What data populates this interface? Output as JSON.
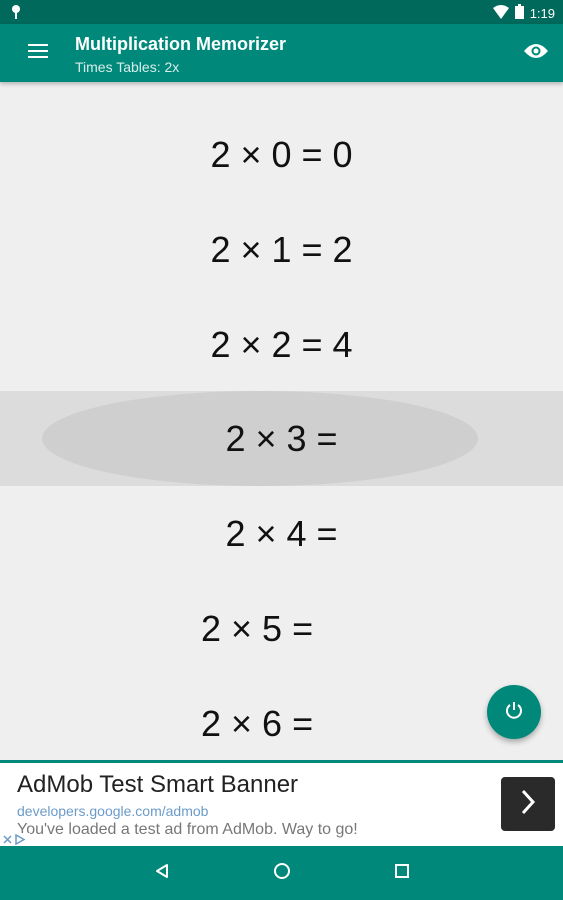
{
  "status_bar": {
    "time": "1:19",
    "icons": [
      "pin-icon",
      "wifi-icon",
      "battery-icon"
    ]
  },
  "app_bar": {
    "title": "Multiplication Memorizer",
    "subtitle": "Times Tables: 2x",
    "icons": [
      "menu-icon",
      "eye-icon"
    ]
  },
  "equations": [
    "2 × 0 = 0",
    "2 × 1 = 2",
    "2 × 2 = 4",
    "2 × 3 =",
    "2 × 4 =",
    "2 × 5 =",
    "2 × 6 ="
  ],
  "fab": {
    "icon": "power-icon"
  },
  "ad": {
    "title": "AdMob Test Smart Banner",
    "url": "developers.google.com/admob",
    "description": "You've loaded a test ad from AdMob. Way to go!",
    "icons": [
      "chevron-right-icon",
      "adchoices-icon"
    ]
  },
  "nav_bar": {
    "icons": [
      "back-icon",
      "home-icon",
      "recents-icon"
    ]
  },
  "colors": {
    "primary": "#00897b",
    "primary_dark": "#00695c",
    "selected_row": "#dcdcdc",
    "background": "#efefef"
  }
}
